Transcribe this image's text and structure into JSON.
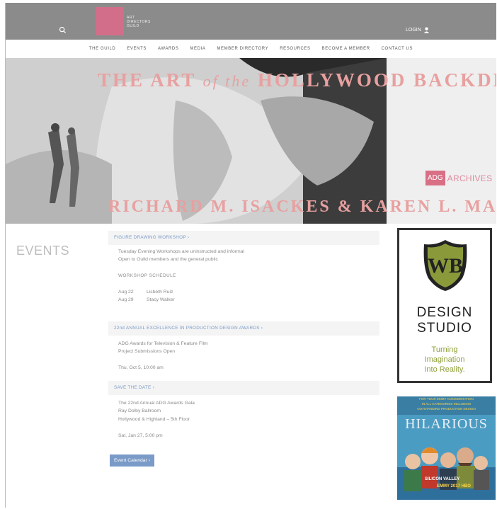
{
  "header": {
    "logo_line1": "ART",
    "logo_line2": "DIRECTORS",
    "logo_line3": "GUILD",
    "login_label": "LOGIN"
  },
  "nav": {
    "items": [
      "THE GUILD",
      "EVENTS",
      "AWARDS",
      "MEDIA",
      "MEMBER DIRECTORY",
      "RESOURCES",
      "BECOME A MEMBER",
      "CONTACT US"
    ]
  },
  "hero": {
    "title_a": "THE ART",
    "title_b": "of the",
    "title_c": "HOLLYWOOD BACKDROP",
    "subtitle": "RICHARD M. ISACKES & KAREN L. MANESS",
    "badge": "ADG",
    "archives": "ARCHIVES"
  },
  "events": {
    "title": "EVENTS",
    "items": [
      {
        "heading": "FIGURE DRAWING WORKSHOP ›",
        "line1": "Tuesday Evening Workshops are uninstructed and informal",
        "line2": "Open to Guild members and the general public",
        "schedule_label": "WORKSHOP SCHEDULE",
        "sched1_date": "Aug 22",
        "sched1_name": "Lisbeth Ruiz",
        "sched2_date": "Aug 29",
        "sched2_name": "Stacy Walker"
      },
      {
        "heading": "22nd ANNUAL EXCELLENCE IN PRODUCTION DESIGN AWARDS ›",
        "line1": "ADG Awards for Television & Feature Film",
        "line2": "Project Submissions Open",
        "date": "Thu, Oct 5, 10:00 am"
      },
      {
        "heading": "SAVE THE DATE ›",
        "line1": "The 22nd Annual ADG Awards Gala",
        "line2": "Ray Dolby Ballroom",
        "line3": "Hollywood & Highland – 5th Floor",
        "date": "Sat, Jan 27, 5:00 pm"
      }
    ],
    "calendar_button": "Event Calendar ›"
  },
  "ads": {
    "wb": {
      "letters": "WB",
      "design": "DESIGN",
      "studio": "STUDIO",
      "tag1": "Turning",
      "tag2": "Imagination",
      "tag3": "Into Reality."
    },
    "hilarious": {
      "top1": "FOR YOUR EMMY CONSIDERATION",
      "top2": "IN ALL CATEGORIES INCLUDING",
      "top3": "OUTSTANDING PRODUCTION DESIGN",
      "word": "HILARIOUS",
      "name": "SILICON VALLEY",
      "emmy": "EMMY 2017 HBO"
    }
  },
  "colors": {
    "topbar": "#8b8b8b",
    "brand_pink": "#d26e8a",
    "link_blue": "#7a9ac8",
    "wb_olive": "#8fa03a"
  }
}
